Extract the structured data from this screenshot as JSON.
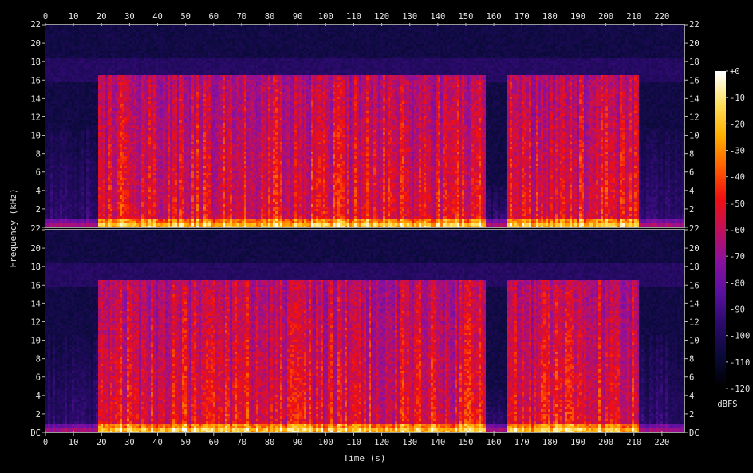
{
  "chart_data": {
    "type": "heatmap",
    "subtype": "stereo spectrogram",
    "channels": 2,
    "xlabel": "Time (s)",
    "ylabel": "Frequency (kHz)",
    "colorbar_label": "dBFS",
    "xlim": [
      0,
      228
    ],
    "ylim": [
      0,
      22
    ],
    "x_ticks": [
      0,
      10,
      20,
      30,
      40,
      50,
      60,
      70,
      80,
      90,
      100,
      110,
      120,
      130,
      140,
      150,
      160,
      170,
      180,
      190,
      200,
      210,
      220
    ],
    "y_ticks": [
      {
        "value": 0,
        "label": ""
      },
      {
        "value": 2,
        "label": "2"
      },
      {
        "value": 4,
        "label": "4"
      },
      {
        "value": 6,
        "label": "6"
      },
      {
        "value": 8,
        "label": "8"
      },
      {
        "value": 10,
        "label": "10"
      },
      {
        "value": 12,
        "label": "12"
      },
      {
        "value": 14,
        "label": "14"
      },
      {
        "value": 16,
        "label": "16"
      },
      {
        "value": 18,
        "label": "18"
      },
      {
        "value": 20,
        "label": "20"
      },
      {
        "value": 22,
        "label": "22"
      }
    ],
    "dc_label": "DC",
    "colorbar_ticks": [
      "+0",
      "-10",
      "-20",
      "-30",
      "-40",
      "-50",
      "-60",
      "-70",
      "-80",
      "-90",
      "-100",
      "-110",
      "-120"
    ],
    "colorbar_range_dbfs": [
      -120,
      0
    ],
    "colormap": [
      "#000000",
      "#0a0a3a",
      "#2a0a6a",
      "#5a10a0",
      "#8a10a0",
      "#c0105a",
      "#f01010",
      "#ff6000",
      "#ffb000",
      "#ffe060",
      "#ffffff"
    ],
    "energy_segments": [
      {
        "start_s": 0,
        "end_s": 18,
        "level": "low",
        "bandwidth_khz": 10
      },
      {
        "start_s": 18,
        "end_s": 157,
        "level": "high",
        "bandwidth_khz": 16
      },
      {
        "start_s": 157,
        "end_s": 164,
        "level": "low",
        "bandwidth_khz": 4
      },
      {
        "start_s": 164,
        "end_s": 211,
        "level": "high",
        "bandwidth_khz": 16
      },
      {
        "start_s": 211,
        "end_s": 228,
        "level": "low",
        "bandwidth_khz": 10
      }
    ]
  }
}
